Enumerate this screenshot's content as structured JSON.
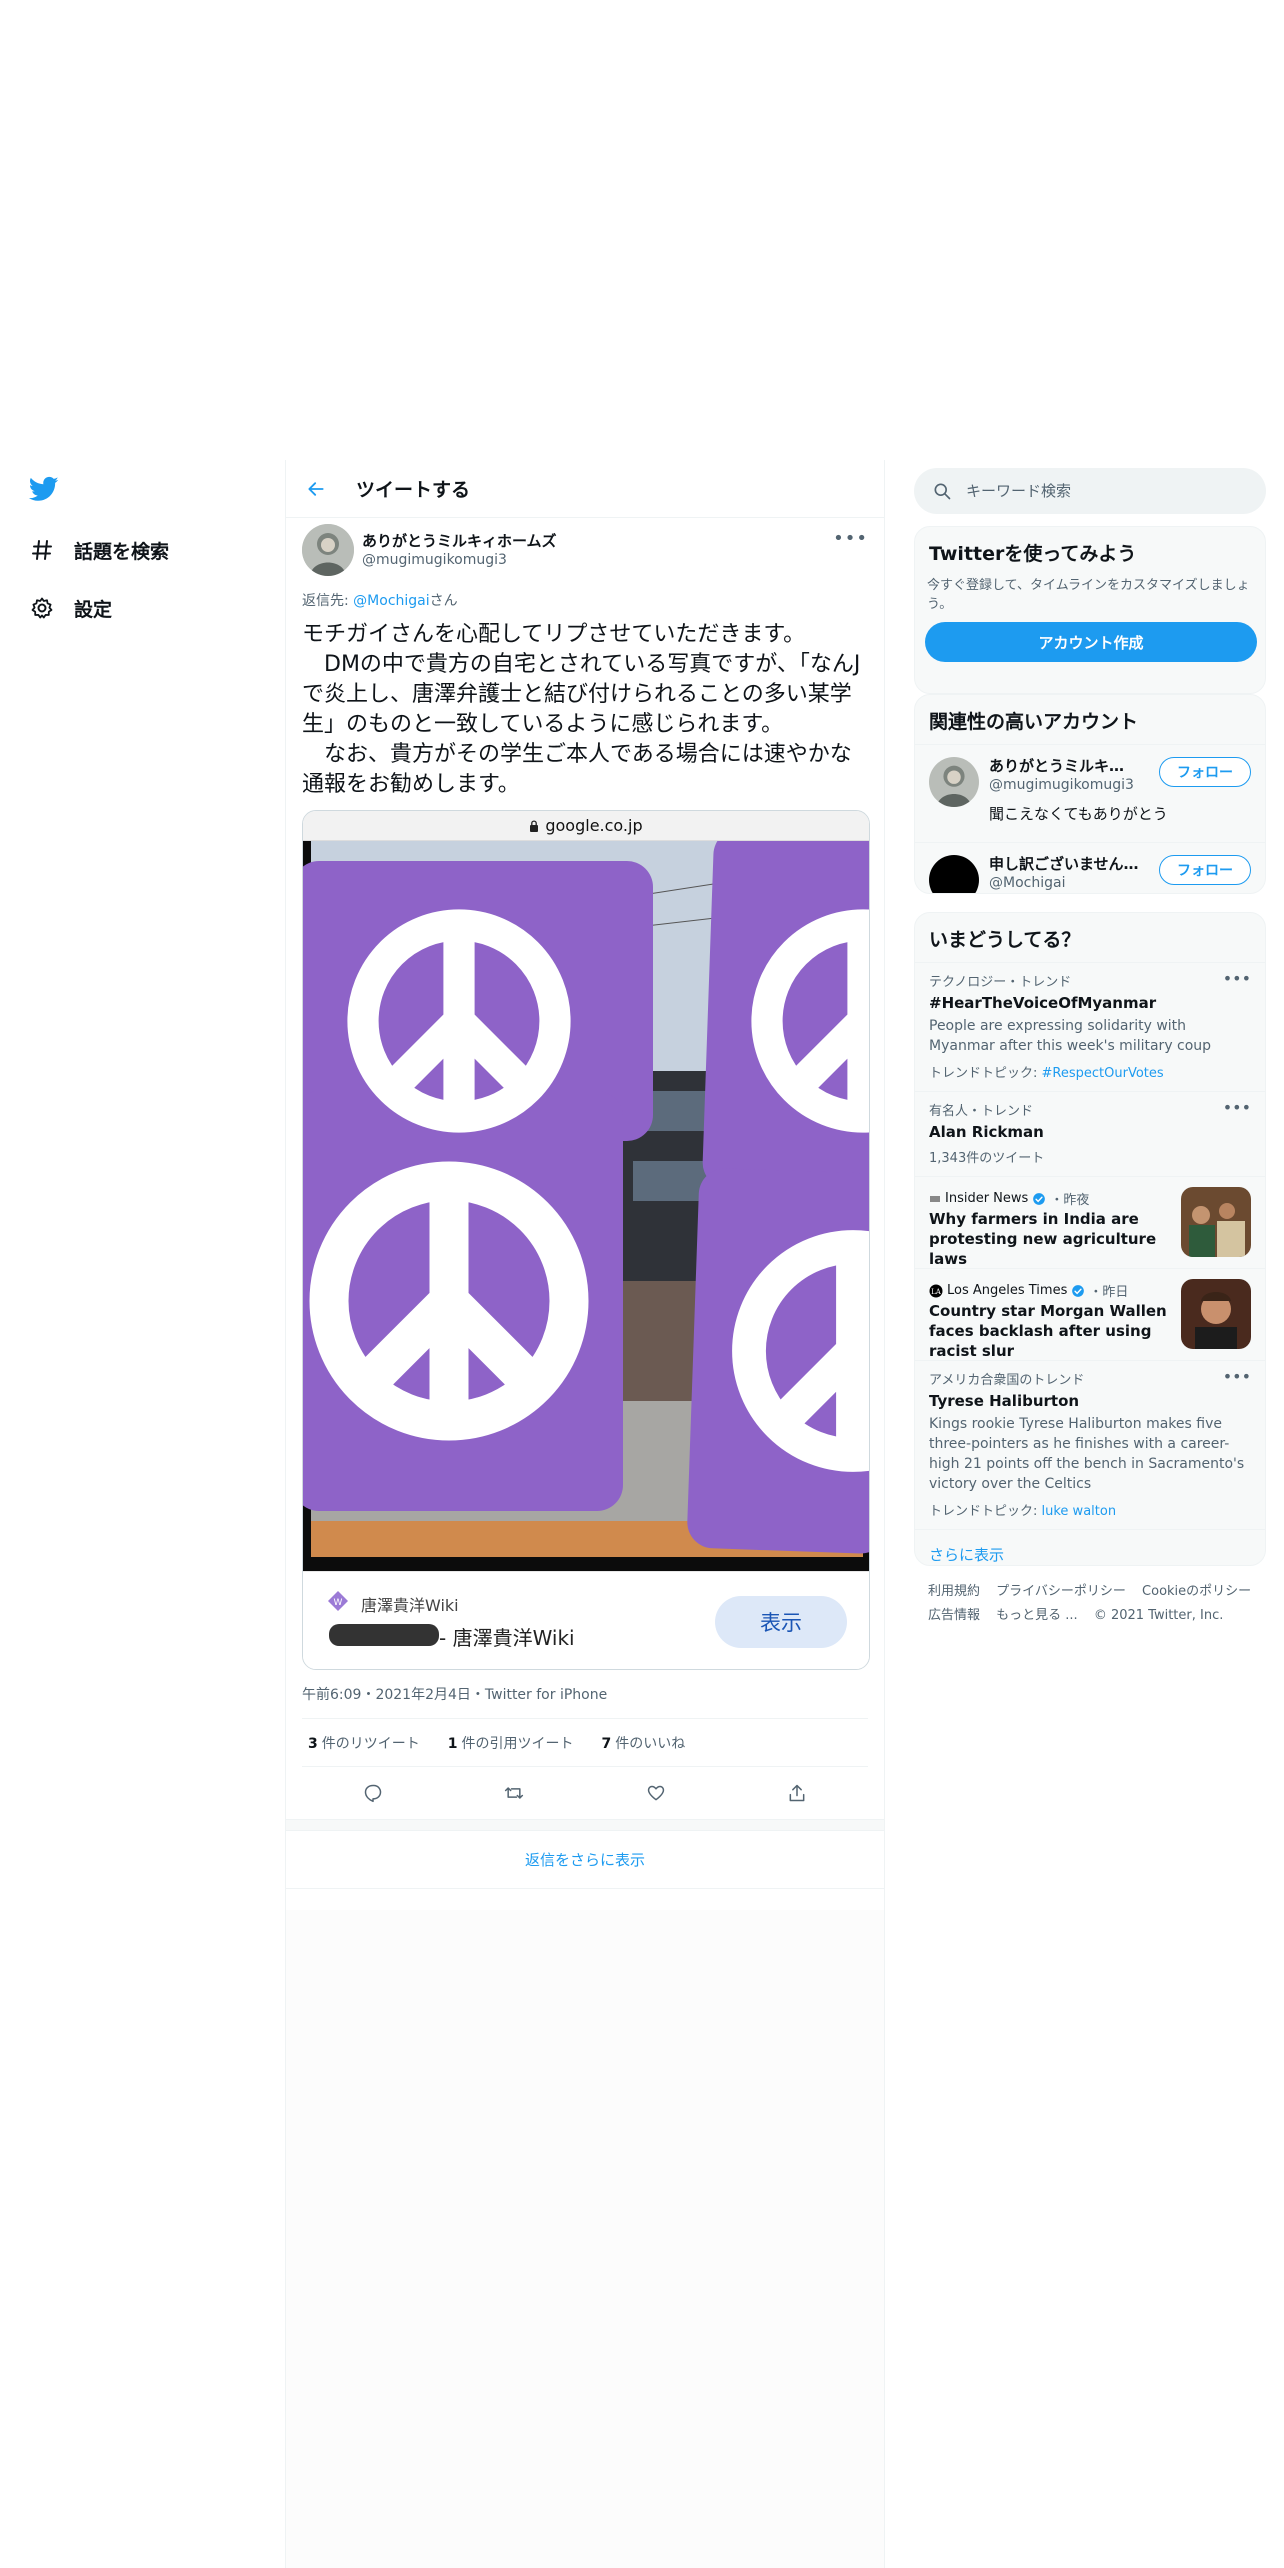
{
  "nav": {
    "items": [
      {
        "label": "話題を検索",
        "icon": "hashtag-icon"
      },
      {
        "label": "設定",
        "icon": "gear-icon"
      }
    ]
  },
  "header": {
    "title": "ツイートする"
  },
  "tweet": {
    "author_name": "ありがとうミルキィホームズ",
    "author_handle": "@mugimugikomugi3",
    "reply_prefix": "返信先: ",
    "reply_handle": "@Mochigai",
    "reply_suffix": "さん",
    "text": "モチガイさんを心配してリプさせていただきます。\n　DMの中で貴方の自宅とされている写真ですが、「なんJで炎上し、唐澤弁護士と結び付けられることの多い某学生」のものと一致しているように感じられます。\n　なお、貴方がその学生ご本人である場合には速やかな通報をお勧めします。",
    "card": {
      "url": "google.co.jp",
      "site_name": "唐澤貴洋Wiki",
      "page_title": "- 唐澤貴洋Wiki",
      "button": "表示"
    },
    "meta": "午前6:09・2021年2月4日・Twitter for iPhone",
    "stats": [
      {
        "count": "3",
        "label": "件のリツイート"
      },
      {
        "count": "1",
        "label": "件の引用ツイート"
      },
      {
        "count": "7",
        "label": "件のいいね"
      }
    ],
    "show_more_replies": "返信をさらに表示"
  },
  "search": {
    "placeholder": "キーワード検索"
  },
  "signup": {
    "title": "Twitterを使ってみよう",
    "text": "今すぐ登録して、タイムラインをカスタマイズしましょう。",
    "button": "アカウント作成"
  },
  "who_to_follow": {
    "title": "関連性の高いアカウント",
    "accounts": [
      {
        "name": "ありがとうミルキィホ…",
        "handle": "@mugimugikomugi3",
        "bio": "聞こえなくてもありがとう",
        "button": "フォロー"
      },
      {
        "name": "申し訳ございません…",
        "handle": "@Mochigai",
        "button": "フォロー"
      }
    ]
  },
  "trends": {
    "title": "いまどうしてる？",
    "items": [
      {
        "context": "テクノロジー・トレンド",
        "title": "#HearTheVoiceOfMyanmar",
        "desc": "People are expressing solidarity with Myanmar after this week's military coup",
        "topic_label": "トレンドトピック: ",
        "topic": "#RespectOurVotes"
      },
      {
        "context": "有名人・トレンド",
        "title": "Alan Rickman",
        "count": "1,343件のツイート"
      }
    ],
    "news": [
      {
        "source": "Insider News",
        "time": "・昨夜",
        "headline": "Why farmers in India are protesting new agriculture laws"
      },
      {
        "source": "Los Angeles Times",
        "time": "・昨日",
        "headline": "Country star Morgan Wallen faces backlash after using racist slur"
      }
    ],
    "last": {
      "context": "アメリカ合衆国のトレンド",
      "title": "Tyrese Haliburton",
      "desc": "Kings rookie Tyrese Haliburton makes five three-pointers as he finishes with a career-high 21 points off the bench in Sacramento's victory over the Celtics",
      "topic_label": "トレンドトピック: ",
      "topic": "luke walton"
    },
    "show_more": "さらに表示"
  },
  "footer": {
    "links": [
      "利用規約",
      "プライバシーポリシー",
      "Cookieのポリシー",
      "広告情報",
      "もっと見る ..."
    ],
    "copyright": "© 2021 Twitter, Inc."
  },
  "colors": {
    "accent": "#1d9bf0",
    "peace_purple": "#8e63c8"
  }
}
